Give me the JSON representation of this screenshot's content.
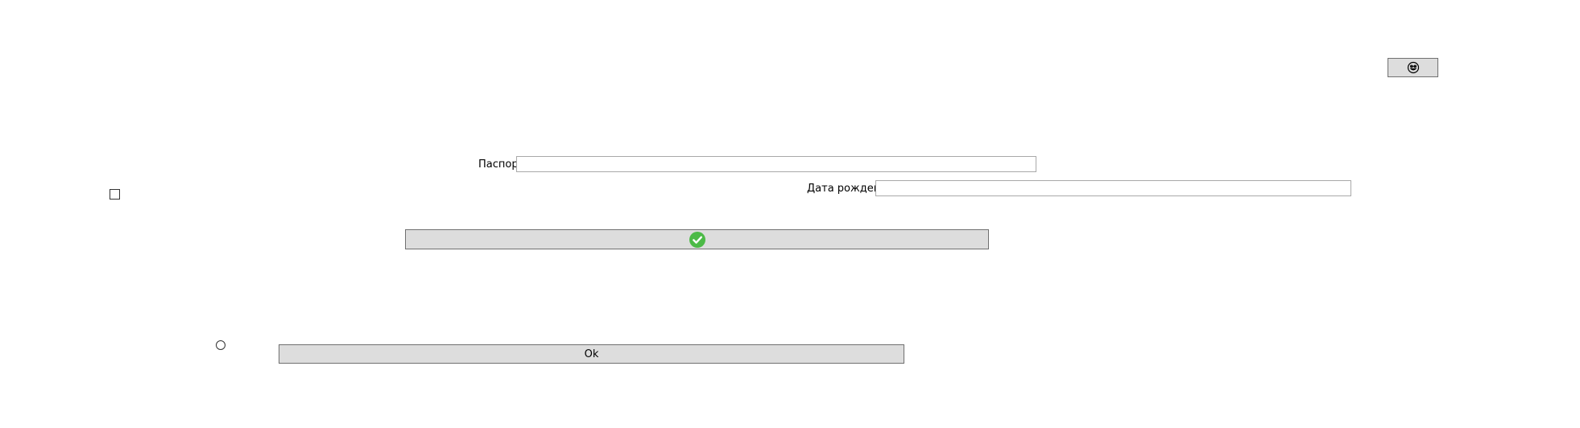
{
  "form": {
    "emoji_button": {
      "icon": "smiley-face-icon"
    },
    "passport": {
      "label": "Паспорт",
      "value": "",
      "placeholder": ""
    },
    "birth_date": {
      "label": "Дата рождения",
      "value": "",
      "placeholder": ""
    },
    "confirm_button": {
      "icon": "check-circle-icon",
      "icon_color": "#4cba47"
    },
    "ok_button": {
      "label": "Ok"
    },
    "checkbox": {
      "checked": false
    },
    "radio": {
      "selected": false
    }
  }
}
